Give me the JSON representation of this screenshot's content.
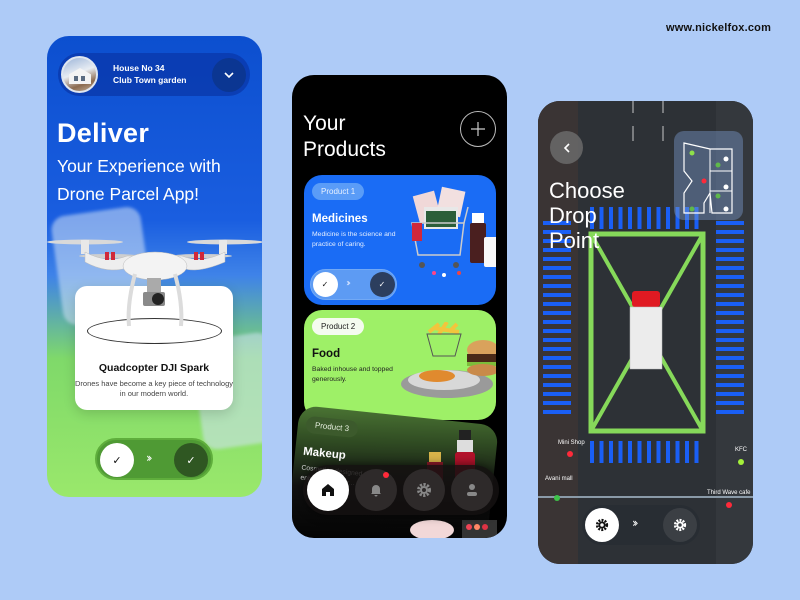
{
  "site_url": "www.nickelfox.com",
  "screen1": {
    "address": {
      "line1": "House No 34",
      "line2": "Club Town garden"
    },
    "hero": {
      "title": "Deliver",
      "subtitle_line1": "Your Experience with",
      "subtitle_line2": "Drone Parcel App!"
    },
    "product_card": {
      "title": "Quadcopter DJI Spark",
      "description": "Drones have become a key piece of technology in our modern world."
    },
    "slider": {
      "start_icon": "✓",
      "arrows": "››",
      "end_icon": "✓"
    },
    "colors": {
      "top": "#0c4fcf",
      "bottom": "#9ae86b"
    }
  },
  "screen2": {
    "title_line1": "Your",
    "title_line2": "Products",
    "add_icon": "+",
    "products": [
      {
        "chip": "Product 1",
        "name": "Medicines",
        "description": "Medicine is the science and practice of caring.",
        "color": "#1a6cf5"
      },
      {
        "chip": "Product 2",
        "name": "Food",
        "description": "Baked inhouse and topped generously.",
        "color": "#9ef067"
      },
      {
        "chip": "Product 3",
        "name": "Makeup",
        "description": "Cosmetics designed to enhance (m... cr...",
        "color": "#4b7534"
      }
    ],
    "slider": {
      "start_icon": "✓",
      "arrows": "››",
      "end_icon": "✓"
    },
    "nav": [
      {
        "name": "home",
        "active": true
      },
      {
        "name": "notifications",
        "badge": true
      },
      {
        "name": "settings"
      },
      {
        "name": "profile"
      }
    ]
  },
  "screen3": {
    "title_line1": "Choose",
    "title_line2": "Drop",
    "title_line3": "Point",
    "back_icon": "‹",
    "places": [
      {
        "label": "Mini  Shop",
        "status": "red"
      },
      {
        "label": "KFC",
        "status": "green"
      },
      {
        "label": "Avani mall",
        "status": "green"
      },
      {
        "label": "Third Wave cafe",
        "status": "red"
      }
    ],
    "slider": {
      "arrows": "››"
    }
  }
}
